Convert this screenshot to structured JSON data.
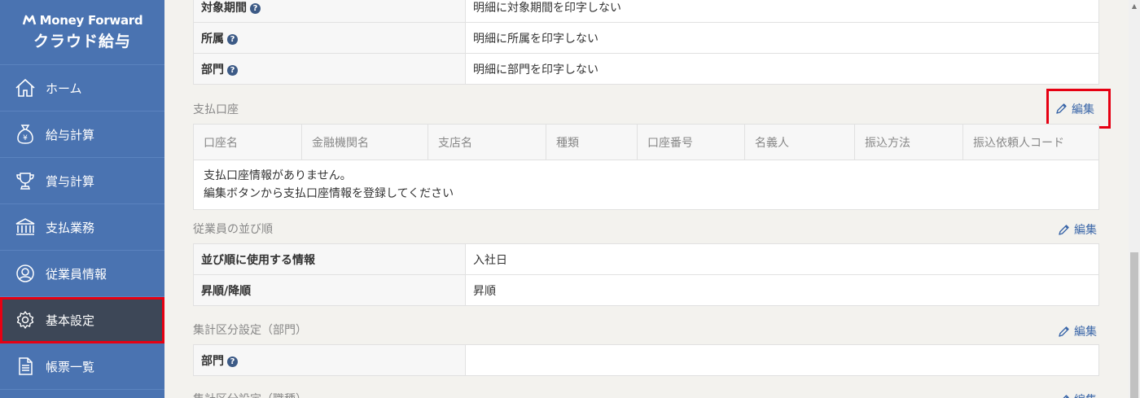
{
  "brand": {
    "line1": "Money Forward",
    "line2": "クラウド給与"
  },
  "nav": [
    {
      "label": "ホーム",
      "icon": "home-icon"
    },
    {
      "label": "給与計算",
      "icon": "money-bag-icon"
    },
    {
      "label": "賞与計算",
      "icon": "trophy-icon"
    },
    {
      "label": "支払業務",
      "icon": "bank-icon"
    },
    {
      "label": "従業員情報",
      "icon": "user-icon"
    },
    {
      "label": "基本設定",
      "icon": "gear-icon",
      "active": true
    },
    {
      "label": "帳票一覧",
      "icon": "document-icon"
    }
  ],
  "print_rows": [
    {
      "key": "対象期間",
      "value": "明細に対象期間を印字しない"
    },
    {
      "key": "所属",
      "value": "明細に所属を印字しない"
    },
    {
      "key": "部門",
      "value": "明細に部門を印字しない"
    }
  ],
  "edit_label": "編集",
  "payment_account": {
    "title": "支払口座",
    "headers": [
      "口座名",
      "金融機関名",
      "支店名",
      "種類",
      "口座番号",
      "名義人",
      "振込方法",
      "振込依頼人コード"
    ],
    "empty_line1": "支払口座情報がありません。",
    "empty_line2": "編集ボタンから支払口座情報を登録してください"
  },
  "employee_order": {
    "title": "従業員の並び順",
    "rows": [
      {
        "key": "並び順に使用する情報",
        "value": "入社日"
      },
      {
        "key": "昇順/降順",
        "value": "昇順"
      }
    ]
  },
  "aggregate_dept": {
    "title": "集計区分設定（部門）",
    "rows": [
      {
        "key": "部門",
        "value": ""
      }
    ]
  },
  "aggregate_job": {
    "title": "集計区分設定（職種）"
  },
  "colors": {
    "sidebar": "#4a73b1",
    "active_nav": "#3d4757",
    "highlight": "#e60012",
    "link": "#3a66a8"
  }
}
